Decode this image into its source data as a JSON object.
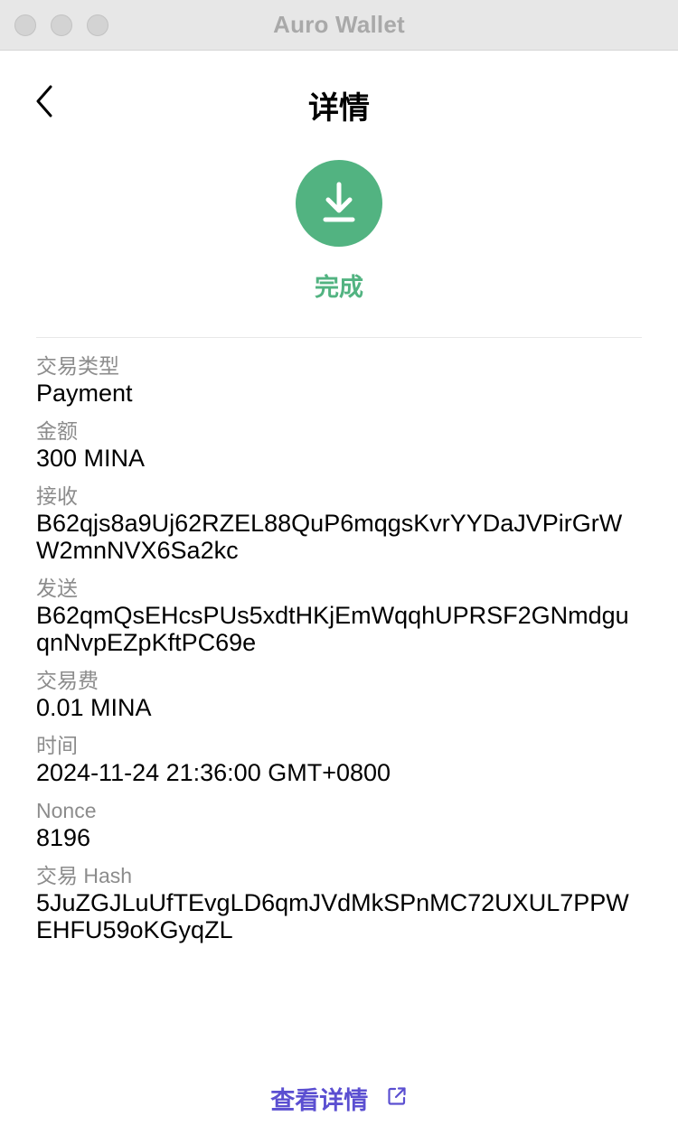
{
  "window": {
    "title": "Auro Wallet"
  },
  "header": {
    "title": "详情"
  },
  "status": {
    "label": "完成",
    "color": "#52b381",
    "icon": "download-arrow-icon"
  },
  "details": {
    "tx_type_label": "交易类型",
    "tx_type_value": "Payment",
    "amount_label": "金额",
    "amount_value": "300 MINA",
    "receiver_label": "接收",
    "receiver_value": "B62qjs8a9Uj62RZEL88QuP6mqgsKvrYYDaJVPirGrWW2mnNVX6Sa2kc",
    "sender_label": "发送",
    "sender_value": "B62qmQsEHcsPUs5xdtHKjEmWqqhUPRSF2GNmdguqnNvpEZpKftPC69e",
    "fee_label": "交易费",
    "fee_value": "0.01 MINA",
    "time_label": "时间",
    "time_value": "2024-11-24 21:36:00 GMT+0800",
    "nonce_label": "Nonce",
    "nonce_value": "8196",
    "hash_label": "交易 Hash",
    "hash_value": "5JuZGJLuUfTEvgLD6qmJVdMkSPnMC72UXUL7PPWEHFU59oKGyqZL"
  },
  "footer": {
    "view_details_label": "查看详情",
    "link_color": "#5b4fd1"
  }
}
